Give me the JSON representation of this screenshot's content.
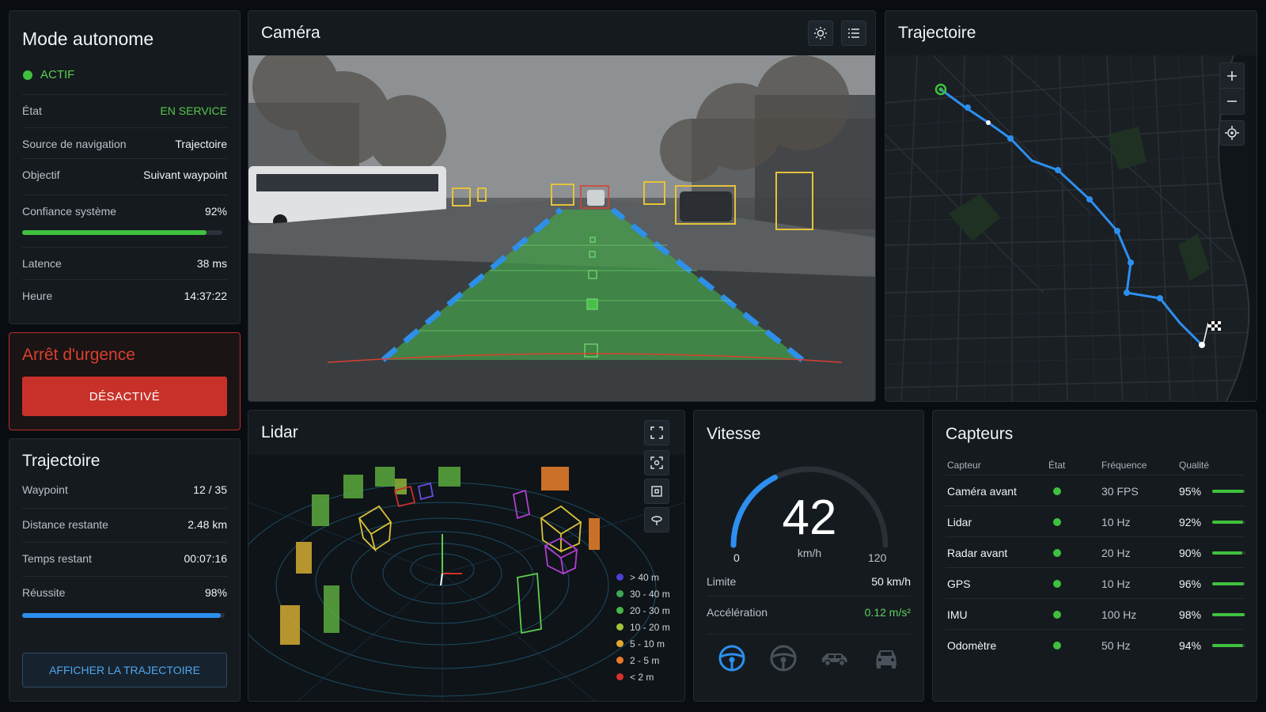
{
  "mode_panel": {
    "title": "Mode autonome",
    "status": "ACTIF",
    "rows": [
      {
        "label": "État",
        "value": "EN SERVICE"
      },
      {
        "label": "Source de navigation",
        "value": "Trajectoire"
      },
      {
        "label": "Objectif",
        "value": "Suivant waypoint"
      },
      {
        "label": "Confiance système",
        "value": "92%"
      },
      {
        "label": "Latence",
        "value": "38 ms"
      },
      {
        "label": "Heure",
        "value": "14:37:22"
      }
    ],
    "confidence_fraction": 0.92
  },
  "emergency": {
    "title": "Arrêt d'urgence",
    "button_label": "DÉSACTIVÉ"
  },
  "trajectory_panel": {
    "title": "Trajectoire",
    "rows": [
      {
        "label": "Waypoint",
        "value": "12 / 35"
      },
      {
        "label": "Distance restante",
        "value": "2.48 km"
      },
      {
        "label": "Temps restant",
        "value": "00:07:16"
      },
      {
        "label": "Réussite",
        "value": "98%"
      }
    ],
    "success_fraction": 0.98,
    "button_label": "AFFICHER LA TRAJECTOIRE"
  },
  "camera": {
    "title": "Caméra",
    "icons": [
      "brightness-icon",
      "list-icon"
    ]
  },
  "map": {
    "title": "Trajectoire",
    "controls": [
      "plus-icon",
      "minus-icon",
      "locate-icon"
    ]
  },
  "lidar": {
    "title": "Lidar",
    "legend": [
      {
        "label": "> 40 m",
        "color": "#4b3fd6"
      },
      {
        "label": "30 - 40 m",
        "color": "#3ba856"
      },
      {
        "label": "20 - 30 m",
        "color": "#46b648"
      },
      {
        "label": "10 - 20 m",
        "color": "#a3c43a"
      },
      {
        "label": "5 - 10 m",
        "color": "#e2a82e"
      },
      {
        "label": "2 - 5 m",
        "color": "#ea7a2a"
      },
      {
        "label": "< 2 m",
        "color": "#d8302a"
      }
    ]
  },
  "speed": {
    "title": "Vitesse",
    "value": "42",
    "unit": "km/h",
    "min": "0",
    "max": "120",
    "rows": [
      {
        "label": "Limite",
        "value": "50 km/h"
      },
      {
        "label": "Accélération",
        "value": "0.12 m/s²"
      }
    ],
    "mode_icons": [
      "steering-wheel-icon",
      "steering-wheel-outline-icon",
      "car-icon",
      "car-front-icon"
    ],
    "accent": "#2d8ff0"
  },
  "sensors": {
    "title": "Capteurs",
    "headers": {
      "name": "Capteur",
      "state": "État",
      "freq": "Fréquence",
      "quality": "Qualité"
    },
    "rows": [
      {
        "name": "Caméra avant",
        "freq": "30 FPS",
        "quality": "95%",
        "q": 0.95
      },
      {
        "name": "Lidar",
        "freq": "10 Hz",
        "quality": "92%",
        "q": 0.92
      },
      {
        "name": "Radar avant",
        "freq": "20 Hz",
        "quality": "90%",
        "q": 0.9
      },
      {
        "name": "GPS",
        "freq": "10 Hz",
        "quality": "96%",
        "q": 0.96
      },
      {
        "name": "IMU",
        "freq": "100 Hz",
        "quality": "98%",
        "q": 0.98
      },
      {
        "name": "Odomètre",
        "freq": "50 Hz",
        "quality": "94%",
        "q": 0.94
      }
    ]
  }
}
